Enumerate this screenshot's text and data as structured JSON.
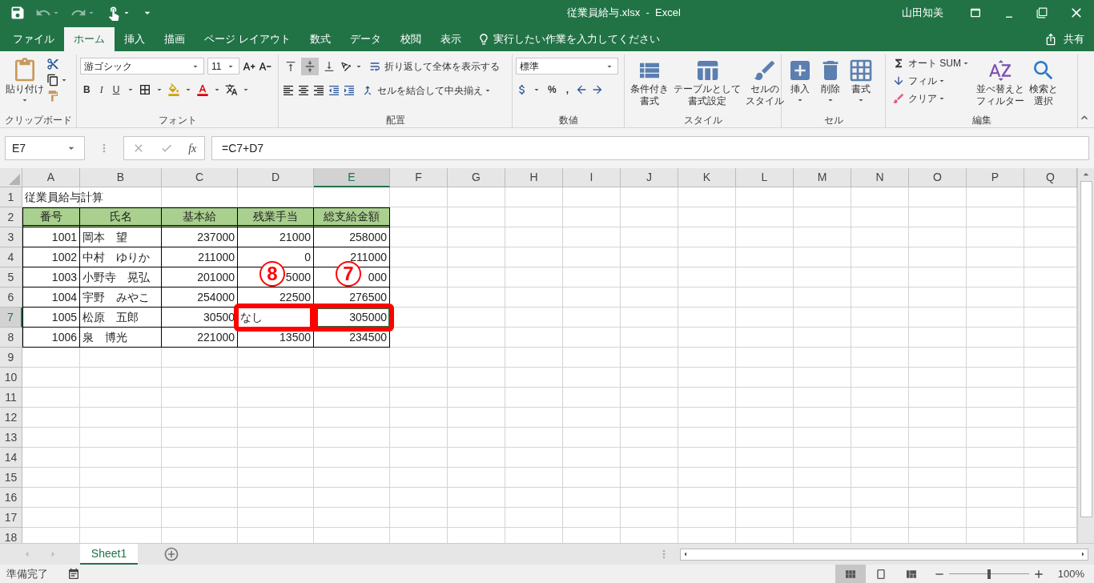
{
  "window": {
    "title": "従業員給与.xlsx  -  Excel",
    "user": "山田知美"
  },
  "menu_tabs": [
    {
      "label": "ファイル",
      "selected": false
    },
    {
      "label": "ホーム",
      "selected": true
    },
    {
      "label": "挿入",
      "selected": false
    },
    {
      "label": "描画",
      "selected": false
    },
    {
      "label": "ページ レイアウト",
      "selected": false
    },
    {
      "label": "数式",
      "selected": false
    },
    {
      "label": "データ",
      "selected": false
    },
    {
      "label": "校閲",
      "selected": false
    },
    {
      "label": "表示",
      "selected": false
    }
  ],
  "tell_me": "実行したい作業を入力してください",
  "share": "共有",
  "ribbon": {
    "clipboard": {
      "paste": "貼り付け",
      "label": "クリップボード"
    },
    "font": {
      "name": "游ゴシック",
      "size": "11",
      "bold": "B",
      "italic": "I",
      "underline": "U",
      "label": "フォント"
    },
    "alignment": {
      "vertical": [
        {
          "selected": false
        },
        {
          "selected": true
        },
        {
          "selected": false
        }
      ],
      "wrap": "折り返して全体を表示する",
      "merge": "セルを結合して中央揃え",
      "label": "配置"
    },
    "number": {
      "format": "標準",
      "percent": "%",
      "comma": ",",
      "label": "数値"
    },
    "styles": {
      "buttons": [
        [
          "条件付き",
          "書式"
        ],
        [
          "テーブルとして",
          "書式設定"
        ],
        [
          "セルの",
          "スタイル"
        ]
      ],
      "label": "スタイル"
    },
    "cells": {
      "buttons": [
        "挿入",
        "削除",
        "書式"
      ],
      "label": "セル"
    },
    "editing": {
      "autosum": "オート SUM",
      "fill": "フィル",
      "clear": "クリア",
      "sort": [
        "並べ替えと",
        "フィルター"
      ],
      "find": [
        "検索と",
        "選択"
      ],
      "label": "編集"
    }
  },
  "formula_bar": {
    "name_box": "E7",
    "fx": "fx",
    "formula": "=C7+D7"
  },
  "columns": [
    {
      "label": "A",
      "selected": false
    },
    {
      "label": "B",
      "selected": false
    },
    {
      "label": "C",
      "selected": false
    },
    {
      "label": "D",
      "selected": false
    },
    {
      "label": "E",
      "selected": true
    },
    {
      "label": "F",
      "selected": false
    },
    {
      "label": "G",
      "selected": false
    },
    {
      "label": "H",
      "selected": false
    },
    {
      "label": "I",
      "selected": false
    },
    {
      "label": "J",
      "selected": false
    },
    {
      "label": "K",
      "selected": false
    },
    {
      "label": "L",
      "selected": false
    },
    {
      "label": "M",
      "selected": false
    },
    {
      "label": "N",
      "selected": false
    },
    {
      "label": "O",
      "selected": false
    },
    {
      "label": "P",
      "selected": false
    },
    {
      "label": "Q",
      "selected": false
    }
  ],
  "rows": [
    {
      "number": "1",
      "selected": false,
      "cells": [
        {
          "kind": "title",
          "text": "従業員給与計算",
          "selected": false,
          "highlight": false
        }
      ]
    },
    {
      "number": "2",
      "selected": false,
      "cells": [
        {
          "kind": "header",
          "text": "番号",
          "selected": false,
          "highlight": false
        },
        {
          "kind": "header",
          "text": "氏名",
          "selected": false,
          "highlight": false
        },
        {
          "kind": "header",
          "text": "基本給",
          "selected": false,
          "highlight": false
        },
        {
          "kind": "header",
          "text": "残業手当",
          "selected": false,
          "highlight": false
        },
        {
          "kind": "header",
          "text": "総支給金額",
          "selected": false,
          "highlight": false
        }
      ]
    },
    {
      "number": "3",
      "selected": false,
      "cells": [
        {
          "kind": "number",
          "text": "1001",
          "selected": false,
          "highlight": false
        },
        {
          "kind": "text",
          "text": "岡本　望",
          "selected": false,
          "highlight": false
        },
        {
          "kind": "number",
          "text": "237000",
          "selected": false,
          "highlight": false
        },
        {
          "kind": "number",
          "text": "21000",
          "selected": false,
          "highlight": false
        },
        {
          "kind": "number",
          "text": "258000",
          "selected": false,
          "highlight": false
        }
      ]
    },
    {
      "number": "4",
      "selected": false,
      "cells": [
        {
          "kind": "number",
          "text": "1002",
          "selected": false,
          "highlight": false
        },
        {
          "kind": "text",
          "text": "中村　ゆりか",
          "selected": false,
          "highlight": false
        },
        {
          "kind": "number",
          "text": "211000",
          "selected": false,
          "highlight": false
        },
        {
          "kind": "number",
          "text": "0",
          "selected": false,
          "highlight": false
        },
        {
          "kind": "number",
          "text": "211000",
          "selected": false,
          "highlight": false
        }
      ]
    },
    {
      "number": "5",
      "selected": false,
      "cells": [
        {
          "kind": "number",
          "text": "1003",
          "selected": false,
          "highlight": false
        },
        {
          "kind": "text",
          "text": "小野寺　晃弘",
          "selected": false,
          "highlight": false
        },
        {
          "kind": "number",
          "text": "201000",
          "selected": false,
          "highlight": false
        },
        {
          "kind": "number",
          "text": "5000",
          "selected": false,
          "highlight": false
        },
        {
          "kind": "number",
          "text": "000",
          "selected": false,
          "highlight": false
        }
      ]
    },
    {
      "number": "6",
      "selected": false,
      "cells": [
        {
          "kind": "number",
          "text": "1004",
          "selected": false,
          "highlight": false
        },
        {
          "kind": "text",
          "text": "宇野　みやこ",
          "selected": false,
          "highlight": false
        },
        {
          "kind": "number",
          "text": "254000",
          "selected": false,
          "highlight": false
        },
        {
          "kind": "number",
          "text": "22500",
          "selected": false,
          "highlight": false
        },
        {
          "kind": "number",
          "text": "276500",
          "selected": false,
          "highlight": false
        }
      ]
    },
    {
      "number": "7",
      "selected": true,
      "cells": [
        {
          "kind": "number",
          "text": "1005",
          "selected": false,
          "highlight": false
        },
        {
          "kind": "text",
          "text": "松原　五郎",
          "selected": false,
          "highlight": false
        },
        {
          "kind": "number",
          "text": "30500",
          "selected": false,
          "highlight": false
        },
        {
          "kind": "text",
          "text": "なし",
          "selected": false,
          "highlight": true,
          "callout": "8"
        },
        {
          "kind": "number",
          "text": "305000",
          "selected": true,
          "highlight": true,
          "callout": "7"
        }
      ]
    },
    {
      "number": "8",
      "selected": false,
      "cells": [
        {
          "kind": "number",
          "text": "1006",
          "selected": false,
          "highlight": false
        },
        {
          "kind": "text",
          "text": "泉　博光",
          "selected": false,
          "highlight": false
        },
        {
          "kind": "number",
          "text": "221000",
          "selected": false,
          "highlight": false
        },
        {
          "kind": "number",
          "text": "13500",
          "selected": false,
          "highlight": false
        },
        {
          "kind": "number",
          "text": "234500",
          "selected": false,
          "highlight": false
        }
      ]
    },
    {
      "number": "9",
      "selected": false,
      "cells": []
    },
    {
      "number": "10",
      "selected": false,
      "cells": []
    },
    {
      "number": "11",
      "selected": false,
      "cells": []
    },
    {
      "number": "12",
      "selected": false,
      "cells": []
    },
    {
      "number": "13",
      "selected": false,
      "cells": []
    },
    {
      "number": "14",
      "selected": false,
      "cells": []
    },
    {
      "number": "15",
      "selected": false,
      "cells": []
    },
    {
      "number": "16",
      "selected": false,
      "cells": []
    },
    {
      "number": "17",
      "selected": false,
      "cells": []
    },
    {
      "number": "18",
      "selected": false,
      "cells": []
    }
  ],
  "sheet_tabs": [
    {
      "label": "Sheet1",
      "selected": true
    }
  ],
  "status_bar": {
    "text": "準備完了",
    "views": [
      {
        "selected": true
      },
      {
        "selected": false
      },
      {
        "selected": false
      }
    ],
    "zoom": {
      "level": 0.5,
      "reading": "100%"
    }
  }
}
